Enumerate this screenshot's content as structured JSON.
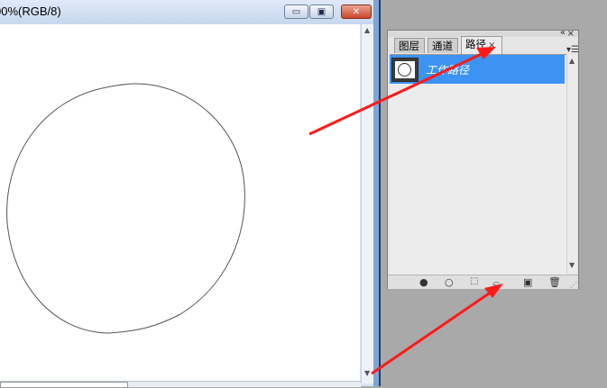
{
  "document": {
    "title": "00%(RGB/8)",
    "buttons": {
      "minimize": "▭",
      "maximize": "▣",
      "close": "✕"
    }
  },
  "panel": {
    "tabs": [
      {
        "label": "图层"
      },
      {
        "label": "通道"
      },
      {
        "label": "路径",
        "active": true
      }
    ],
    "tab_close": "×",
    "collapse": "«",
    "close": "×",
    "menu": "▾☰",
    "paths": [
      {
        "name": "工作路径",
        "selected": true
      }
    ],
    "bottom_icons": [
      "fill-path-icon",
      "stroke-path-icon",
      "load-selection-icon",
      "make-work-path-icon",
      "new-path-icon",
      "delete-path-icon"
    ]
  },
  "colors": {
    "selection": "#3d93f1",
    "arrow": "#ff1a1a",
    "workspace": "#a9a9a9"
  }
}
